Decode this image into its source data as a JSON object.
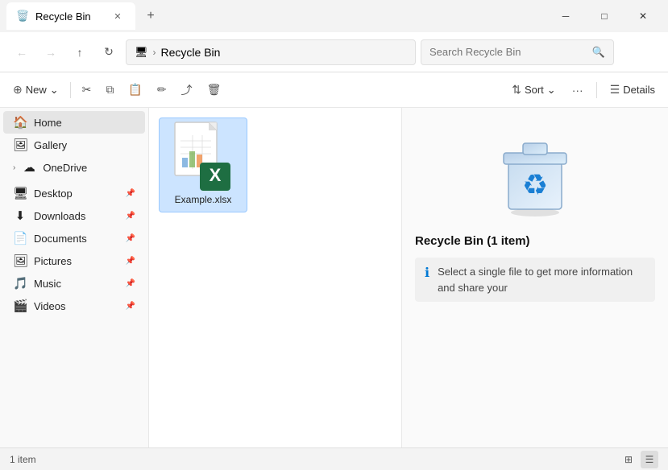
{
  "window": {
    "title": "Recycle Bin",
    "tab_icon": "🗑️"
  },
  "title_bar": {
    "tab_label": "Recycle Bin",
    "new_tab_label": "+",
    "close_label": "✕",
    "minimize_label": "─",
    "maximize_label": "□",
    "window_close_label": "✕"
  },
  "address_bar": {
    "back_icon": "←",
    "forward_icon": "→",
    "up_icon": "↑",
    "refresh_icon": "↻",
    "monitor_icon": "🖥",
    "separator": "›",
    "breadcrumb_text": "Recycle Bin",
    "search_placeholder": "Search Recycle Bin",
    "search_icon": "🔍"
  },
  "toolbar": {
    "new_label": "New",
    "new_icon": "⊕",
    "new_arrow": "⌄",
    "cut_icon": "✂",
    "copy_icon": "⧉",
    "paste_icon": "📋",
    "rename_icon": "✏",
    "share_icon": "⤴",
    "delete_icon": "🗑",
    "sort_label": "Sort",
    "sort_icon": "⇅",
    "sort_arrow": "⌄",
    "more_icon": "···",
    "details_label": "Details",
    "details_icon": "☰"
  },
  "sidebar": {
    "items": [
      {
        "label": "Home",
        "icon": "🏠",
        "active": true,
        "pin": false,
        "expand": false
      },
      {
        "label": "Gallery",
        "icon": "🖼",
        "active": false,
        "pin": false,
        "expand": false
      },
      {
        "label": "OneDrive",
        "icon": "☁",
        "active": false,
        "pin": false,
        "expand": true
      },
      {
        "label": "Desktop",
        "icon": "🖥",
        "active": false,
        "pin": true,
        "expand": false
      },
      {
        "label": "Downloads",
        "icon": "⬇",
        "active": false,
        "pin": true,
        "expand": false
      },
      {
        "label": "Documents",
        "icon": "📄",
        "active": false,
        "pin": true,
        "expand": false
      },
      {
        "label": "Pictures",
        "icon": "🖼",
        "active": false,
        "pin": true,
        "expand": false
      },
      {
        "label": "Music",
        "icon": "🎵",
        "active": false,
        "pin": true,
        "expand": false
      },
      {
        "label": "Videos",
        "icon": "🎬",
        "active": false,
        "pin": true,
        "expand": false
      }
    ]
  },
  "files": [
    {
      "name": "Example.xlsx",
      "type": "excel"
    }
  ],
  "details": {
    "title": "Recycle Bin (1 item)",
    "info_text": "Select a single file to get more information and share your",
    "recycle_icon": "♻"
  },
  "status_bar": {
    "count_text": "1 item",
    "view_grid_icon": "⊞",
    "view_list_icon": "☰"
  }
}
